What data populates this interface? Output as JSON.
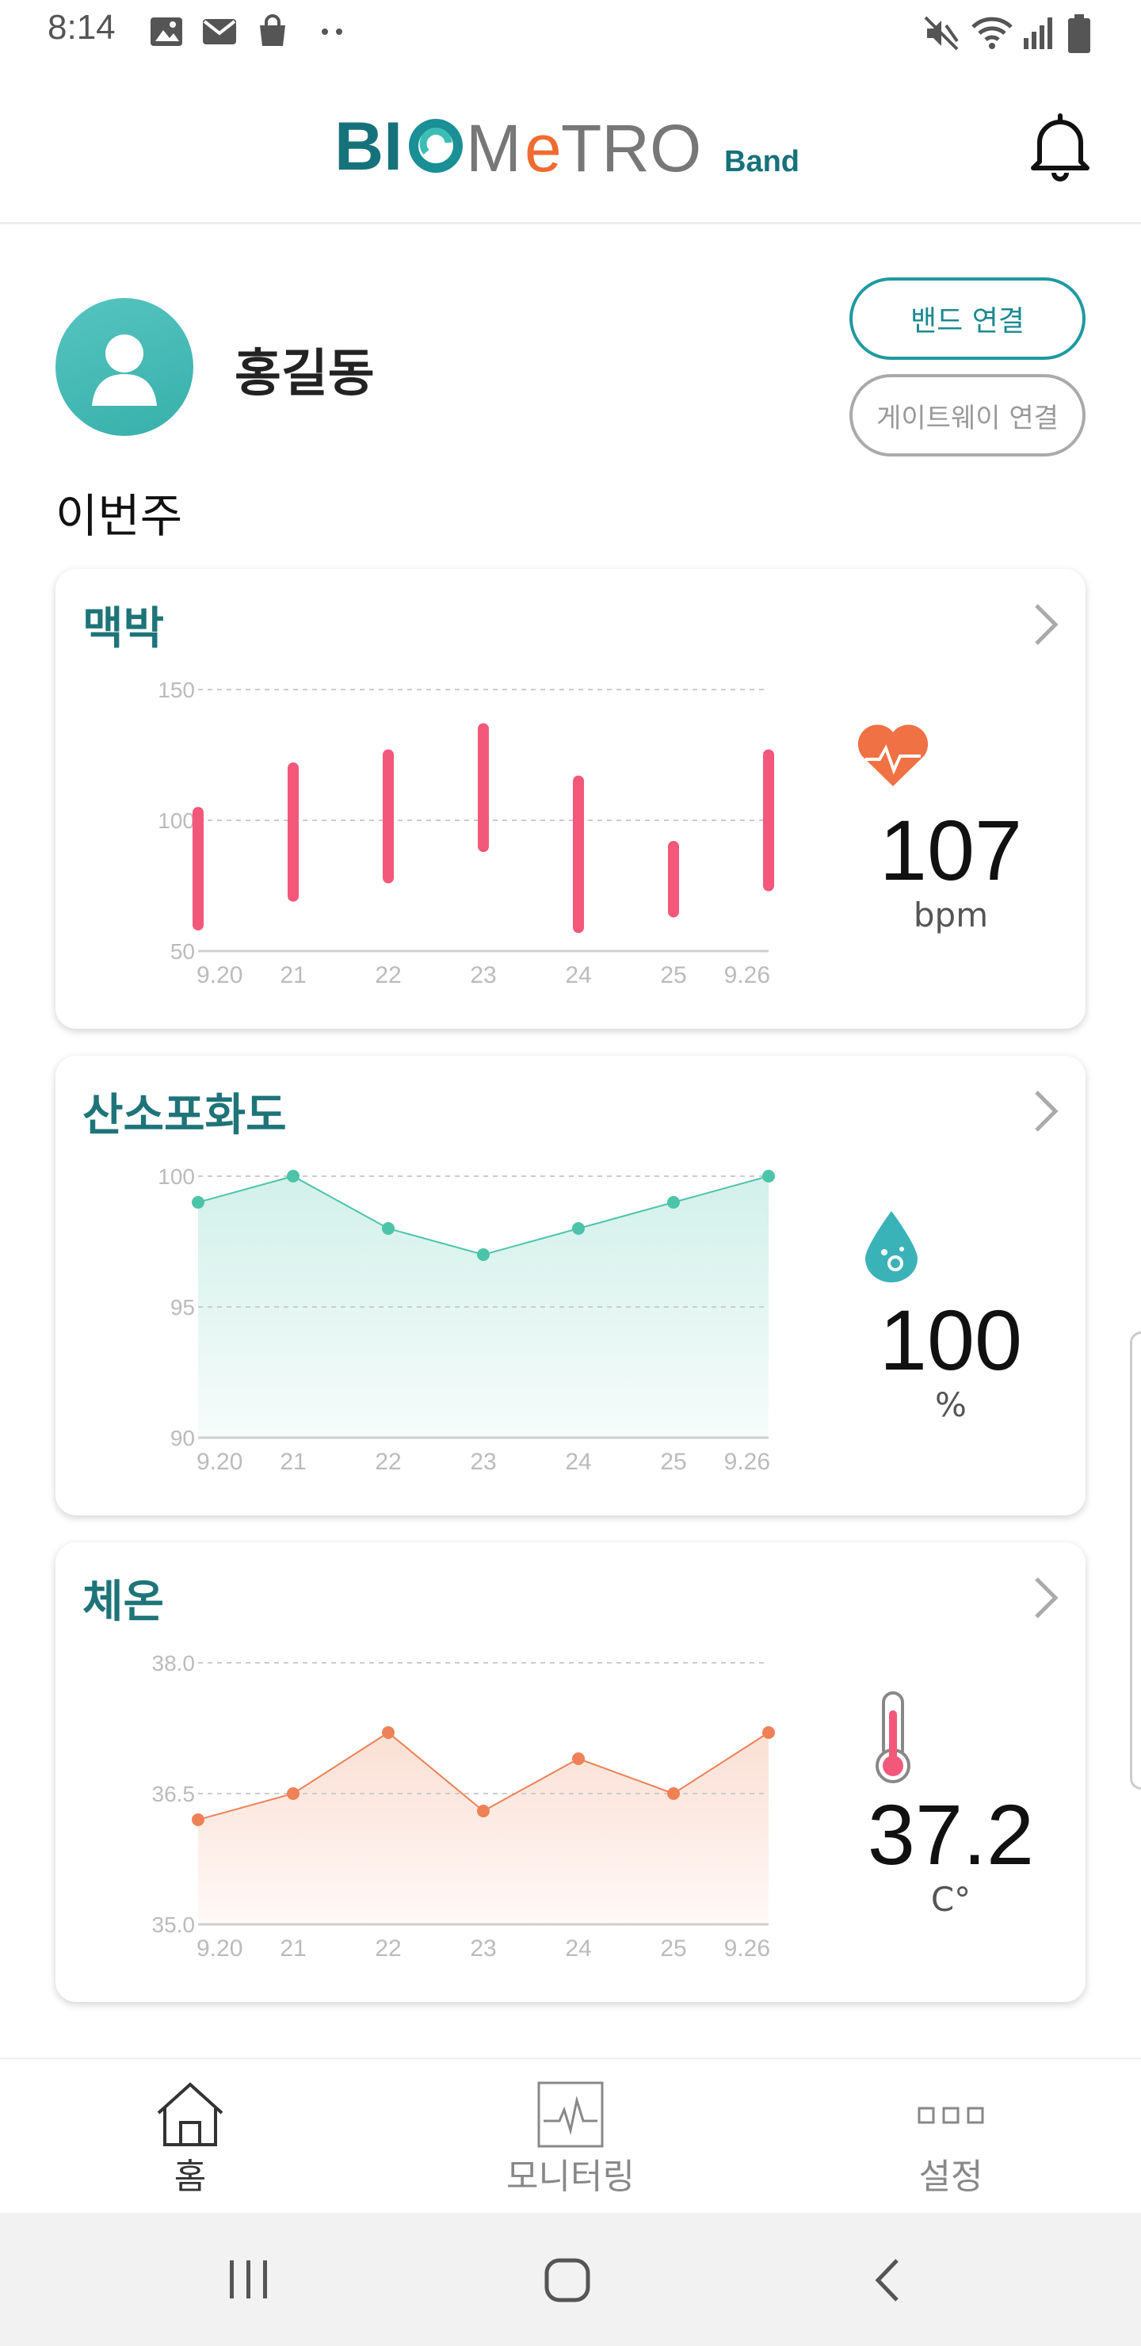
{
  "status": {
    "time": "8:14"
  },
  "app": {
    "logo_main": "BIOMETRO",
    "logo_sub": "Band"
  },
  "profile": {
    "name": "홍길동",
    "band_button": "밴드 연결",
    "gateway_button": "게이트웨이 연결"
  },
  "section_label": "이번주",
  "colors": {
    "teal": "#1e7478",
    "pulse": "#f3587a",
    "spo2": "#4cc4a9",
    "temp": "#ee8155",
    "heart_icon": "#ef7144",
    "drop_icon": "#3ab3b8"
  },
  "cards": {
    "pulse": {
      "title": "맥박",
      "value": "107",
      "unit": "bpm",
      "icon": "heart-pulse-icon"
    },
    "spo2": {
      "title": "산소포화도",
      "value": "100",
      "unit": "%",
      "icon": "water-drop-icon"
    },
    "temp": {
      "title": "체온",
      "value": "37.2",
      "unit": "C°",
      "icon": "thermometer-icon"
    }
  },
  "chart_data": [
    {
      "type": "bar",
      "subtype": "range",
      "categories": [
        "9.20",
        "21",
        "22",
        "23",
        "24",
        "25",
        "9.26"
      ],
      "ranges": [
        [
          60,
          103
        ],
        [
          71,
          120
        ],
        [
          78,
          125
        ],
        [
          90,
          135
        ],
        [
          59,
          115
        ],
        [
          65,
          90
        ],
        [
          75,
          125
        ]
      ],
      "ylim": [
        50,
        150
      ],
      "yticks": [
        "50",
        "100",
        "150"
      ],
      "grid": true
    },
    {
      "type": "area",
      "categories": [
        "9.20",
        "21",
        "22",
        "23",
        "24",
        "25",
        "9.26"
      ],
      "values": [
        99,
        100,
        98,
        97,
        98,
        99,
        100
      ],
      "ylim": [
        90,
        100
      ],
      "yticks": [
        "90",
        "95",
        "100"
      ],
      "grid": true
    },
    {
      "type": "area",
      "categories": [
        "9.20",
        "21",
        "22",
        "23",
        "24",
        "25",
        "9.26"
      ],
      "values": [
        36.2,
        36.5,
        37.2,
        36.3,
        36.9,
        36.5,
        37.2
      ],
      "ylim": [
        35.0,
        38.0
      ],
      "yticks": [
        "35.0",
        "36.5",
        "38.0"
      ],
      "grid": true
    }
  ],
  "nav": {
    "home": "홈",
    "monitoring": "모니터링",
    "settings": "설정",
    "active": "home"
  }
}
